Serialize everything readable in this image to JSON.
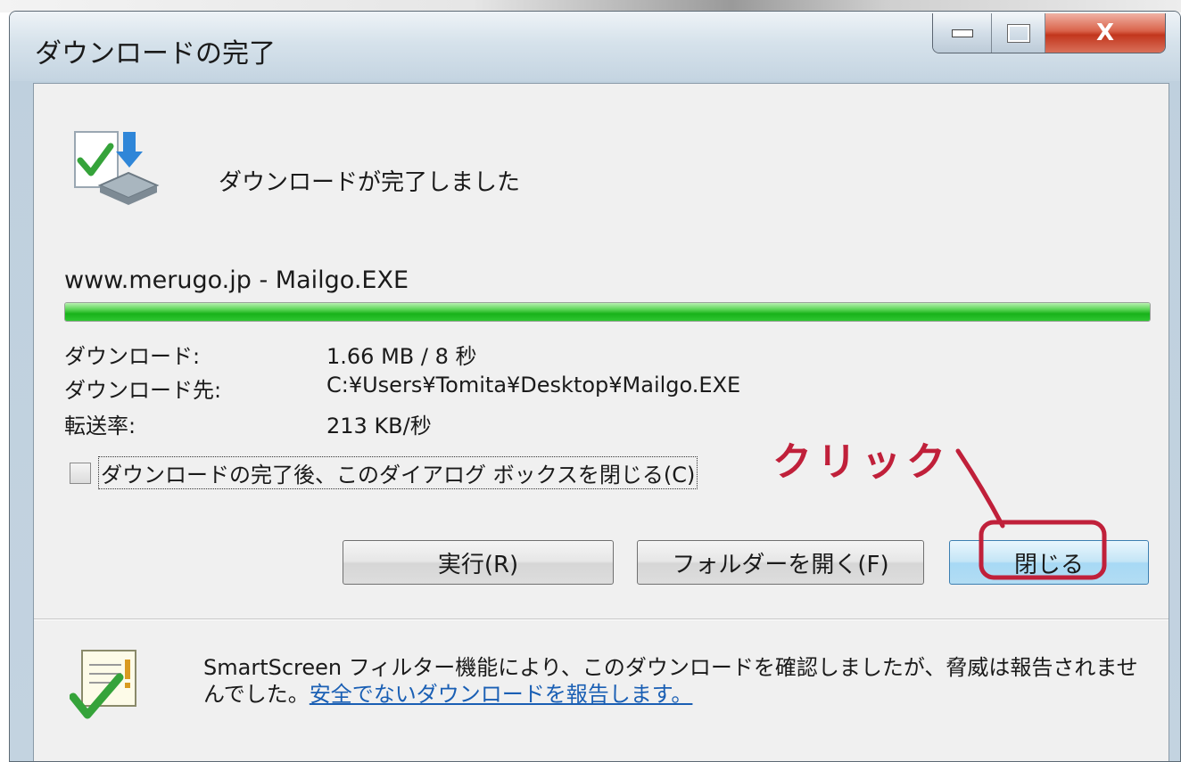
{
  "window": {
    "title": "ダウンロードの完了",
    "close_glyph": "X"
  },
  "header": {
    "message": "ダウンロードが完了しました",
    "icon": "download-complete-icon"
  },
  "download": {
    "file_label": "www.merugo.jp - Mailgo.EXE",
    "progress_percent": 100,
    "rows": [
      {
        "label": "ダウンロード:",
        "value": "1.66 MB / 8 秒"
      },
      {
        "label": "ダウンロード先:",
        "value": "C:¥Users¥Tomita¥Desktop¥Mailgo.EXE"
      },
      {
        "label": "転送率:",
        "value": "213 KB/秒"
      }
    ]
  },
  "options": {
    "close_on_complete_label": "ダウンロードの完了後、このダイアログ ボックスを閉じる(C)",
    "close_on_complete_checked": false
  },
  "annotation": {
    "text": "クリック",
    "color": "#c0203a"
  },
  "buttons": {
    "run": "実行(R)",
    "open_folder": "フォルダーを開く(F)",
    "close": "閉じる"
  },
  "smartscreen": {
    "text": "SmartScreen フィルター機能により、このダウンロードを確認しましたが、脅威は報告されませんでした。",
    "link": "安全でないダウンロードを報告します。",
    "icon": "smartscreen-check-icon"
  },
  "colors": {
    "progress": "#22b822",
    "link": "#1a5fb4",
    "title_bar": "#c4d4e1"
  }
}
